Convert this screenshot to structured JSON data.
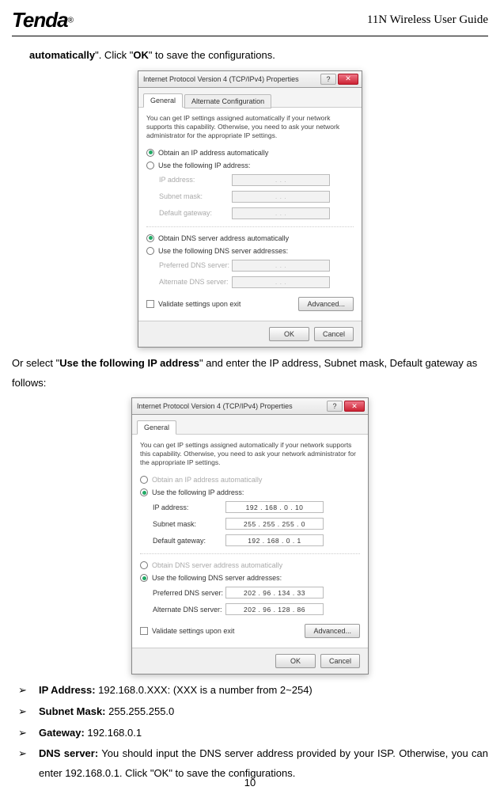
{
  "header": {
    "logo": "Tenda",
    "reg": "®",
    "title_prefix": "11N Wireless",
    "title_suffix": " User Guide"
  },
  "para1": {
    "pre": "automatically",
    "mid1": "\". Click \"",
    "ok": "OK",
    "mid2": "\" to save the configurations."
  },
  "para2": {
    "pre": "Or select \"",
    "bold": "Use the following IP address",
    "post": "\" and enter the IP address, Subnet mask, Default gateway as follows:"
  },
  "dialog1": {
    "title": "Internet Protocol Version 4 (TCP/IPv4) Properties",
    "help": "?",
    "close": "✕",
    "tab_general": "General",
    "tab_alt": "Alternate Configuration",
    "intro": "You can get IP settings assigned automatically if your network supports this capability. Otherwise, you need to ask your network administrator for the appropriate IP settings.",
    "r_auto_ip": "Obtain an IP address automatically",
    "r_use_ip": "Use the following IP address:",
    "lbl_ip": "IP address:",
    "lbl_mask": "Subnet mask:",
    "lbl_gw": "Default gateway:",
    "r_auto_dns": "Obtain DNS server address automatically",
    "r_use_dns": "Use the following DNS server addresses:",
    "lbl_pdns": "Preferred DNS server:",
    "lbl_adns": "Alternate DNS server:",
    "chk_validate": "Validate settings upon exit",
    "btn_adv": "Advanced...",
    "btn_ok": "OK",
    "btn_cancel": "Cancel",
    "dots": ".       .       ."
  },
  "dialog2": {
    "title": "Internet Protocol Version 4 (TCP/IPv4) Properties",
    "help": "?",
    "close": "✕",
    "tab_general": "General",
    "intro": "You can get IP settings assigned automatically if your network supports this capability. Otherwise, you need to ask your network administrator for the appropriate IP settings.",
    "r_auto_ip": "Obtain an IP address automatically",
    "r_use_ip": "Use the following IP address:",
    "lbl_ip": "IP address:",
    "lbl_mask": "Subnet mask:",
    "lbl_gw": "Default gateway:",
    "val_ip": "192 . 168 .  0  . 10",
    "val_mask": "255 . 255 . 255 .  0",
    "val_gw": "192 . 168 .  0  .  1",
    "r_auto_dns": "Obtain DNS server address automatically",
    "r_use_dns": "Use the following DNS server addresses:",
    "lbl_pdns": "Preferred DNS server:",
    "lbl_adns": "Alternate DNS server:",
    "val_pdns": "202 . 96  . 134 . 33",
    "val_adns": "202 . 96  . 128 . 86",
    "chk_validate": "Validate settings upon exit",
    "btn_adv": "Advanced...",
    "btn_ok": "OK",
    "btn_cancel": "Cancel"
  },
  "bullets": {
    "mark": "➢",
    "b1_label": "IP Address:",
    "b1_text": " 192.168.0.XXX: (XXX is a number from 2~254)",
    "b2_label": "Subnet Mask:",
    "b2_text": " 255.255.255.0",
    "b3_label": "Gateway:",
    "b3_text": " 192.168.0.1",
    "b4_label": "DNS server:",
    "b4_text": " You should input the DNS server address provided by your ISP. Otherwise, you can enter 192.168.0.1. Click \"OK\" to save the configurations."
  },
  "page": "10"
}
